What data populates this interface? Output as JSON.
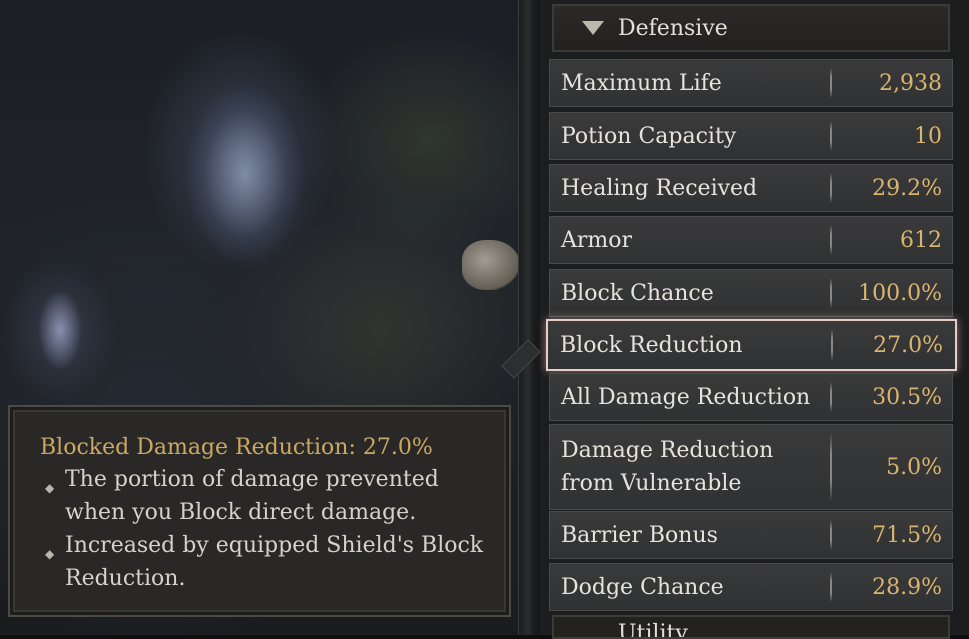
{
  "tooltip": {
    "title": "Blocked Damage Reduction: 27.0%",
    "bullets": [
      "The portion of damage prevented when you Block direct damage.",
      "Increased by equipped Shield's Block Reduction."
    ]
  },
  "section": {
    "label": "Defensive"
  },
  "stats": [
    {
      "name": "Maximum Life",
      "value": "2,938"
    },
    {
      "name": "Potion Capacity",
      "value": "10"
    },
    {
      "name": "Healing Received",
      "value": "29.2%"
    },
    {
      "name": "Armor",
      "value": "612"
    },
    {
      "name": "Block Chance",
      "value": "100.0%"
    },
    {
      "name": "Block Reduction",
      "value": "27.0%"
    },
    {
      "name": "All Damage Reduction",
      "value": "30.5%"
    },
    {
      "name": "Damage Reduction from Vulnerable",
      "value": "5.0%"
    },
    {
      "name": "Barrier Bonus",
      "value": "71.5%"
    },
    {
      "name": "Dodge Chance",
      "value": "28.9%"
    }
  ],
  "next_section": {
    "label": "Utility"
  },
  "colors": {
    "value_gold": "#d9b46f",
    "title_gold": "#c9a963",
    "highlight": "#e7cfc8"
  }
}
